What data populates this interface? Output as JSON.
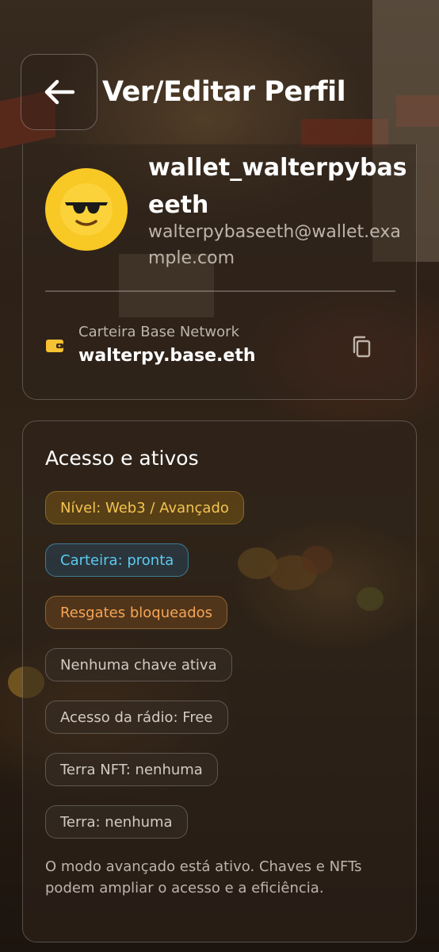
{
  "header": {
    "title": "Ver/Editar Perfil"
  },
  "profile": {
    "avatar_emoji": "😎",
    "username": "wallet_walterpybaseeth",
    "email": "walterpybaseeth@wallet.example.com",
    "wallet_caption": "Carteira Base Network",
    "wallet_address": "walterpy.base.eth"
  },
  "access": {
    "title": "Acesso e ativos",
    "chips": [
      {
        "label": "Nível: Web3 / Avançado",
        "style": "gold"
      },
      {
        "label": "Carteira: pronta",
        "style": "blue"
      },
      {
        "label": "Resgates bloqueados",
        "style": "orange"
      },
      {
        "label": "Nenhuma chave ativa",
        "style": "gray"
      },
      {
        "label": "Acesso da rádio: Free",
        "style": "gray"
      },
      {
        "label": "Terra NFT: nenhuma",
        "style": "gray"
      },
      {
        "label": "Terra: nenhuma",
        "style": "gray"
      }
    ],
    "footnote": "O modo avançado está ativo. Chaves e NFTs podem ampliar o acesso e a eficiência."
  },
  "colors": {
    "accent_gold": "#f3c451",
    "accent_blue": "#5ccaf0",
    "accent_orange": "#f6a454",
    "avatar_bg": "#f8c824"
  },
  "icons": [
    "back-arrow-icon",
    "wallet-icon",
    "copy-icon"
  ]
}
